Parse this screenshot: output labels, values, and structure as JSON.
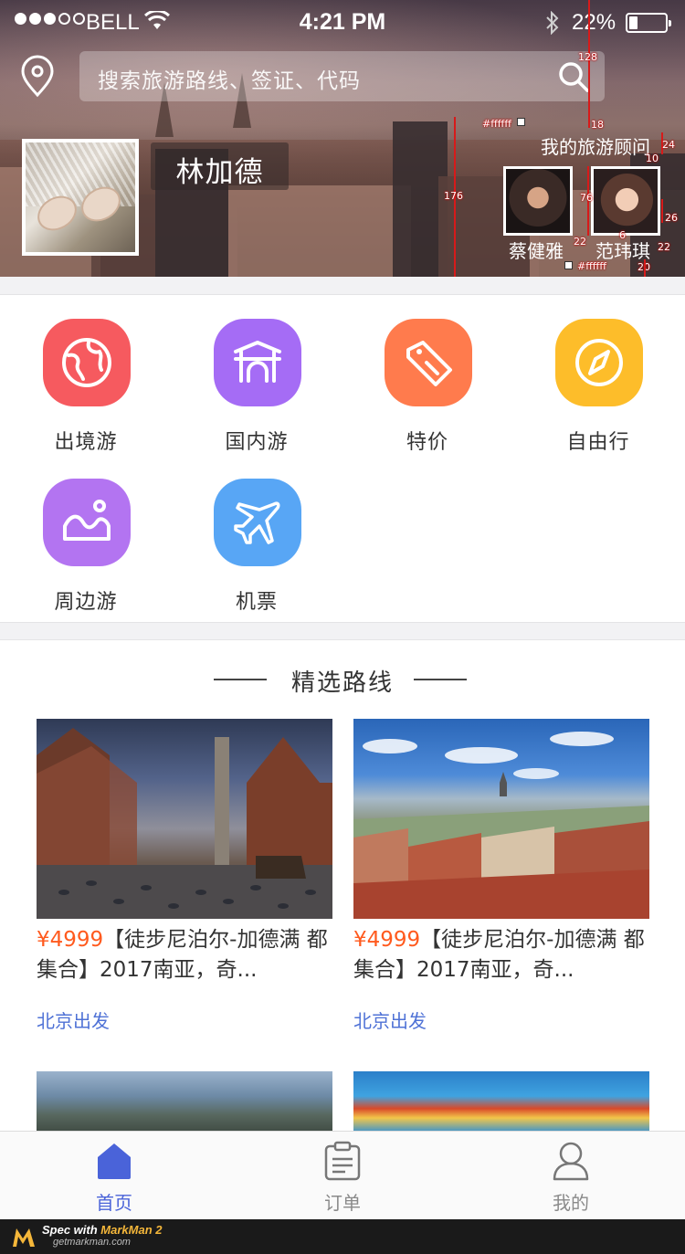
{
  "status_bar": {
    "carrier": "BELL",
    "time": "4:21 PM",
    "battery": "22%",
    "battery_level": 0.22,
    "signal_bars_filled": 3,
    "signal_bars_total": 5
  },
  "header": {
    "location_icon": "location-pin-icon",
    "search_placeholder": "搜索旅游路线、签证、代码",
    "search_icon": "search-icon",
    "user_name": "林加德",
    "advisor_title": "我的旅游顾问",
    "advisors": [
      {
        "name": "蔡健雅"
      },
      {
        "name": "范玮琪"
      }
    ]
  },
  "spec_annotations": {
    "height_top": "128",
    "gap_title": "18",
    "title_height": "24",
    "title_gap": "10",
    "header_height": "176",
    "avatar_size": "76",
    "avatar_gap": "26",
    "name_gap_left": "22",
    "name_gap_right": "22",
    "inner_gap": "6",
    "bottom_gap": "20",
    "color_top": "#ffffff",
    "color_bottom": "#ffffff"
  },
  "categories": [
    {
      "label": "出境游",
      "icon": "globe-icon",
      "color": "#f65a5f"
    },
    {
      "label": "国内游",
      "icon": "gate-icon",
      "color": "#a56cf5"
    },
    {
      "label": "特价",
      "icon": "tag-icon",
      "color": "#ff7b4d"
    },
    {
      "label": "自由行",
      "icon": "compass-icon",
      "color": "#fdbd2a"
    },
    {
      "label": "周边游",
      "icon": "mountain-icon",
      "color": "#b374f1"
    },
    {
      "label": "机票",
      "icon": "airplane-icon",
      "color": "#58a6f5"
    }
  ],
  "featured": {
    "title": "精选路线",
    "routes": [
      {
        "price": "¥4999",
        "title": "【徒步尼泊尔-加德满 都集合】2017南亚，奇...",
        "depart": "北京出发"
      },
      {
        "price": "¥4999",
        "title": "【徒步尼泊尔-加德满 都集合】2017南亚，奇...",
        "depart": "北京出发"
      }
    ]
  },
  "tabbar": {
    "tabs": [
      {
        "label": "首页",
        "icon": "home-icon"
      },
      {
        "label": "订单",
        "icon": "order-icon"
      },
      {
        "label": "我的",
        "icon": "profile-icon"
      }
    ],
    "active_index": 0,
    "active_color": "#4a63d9"
  },
  "watermark": {
    "line1_prefix": "Spec with ",
    "line1_brand": "MarkMan 2",
    "line2": "getmarkman.com"
  }
}
